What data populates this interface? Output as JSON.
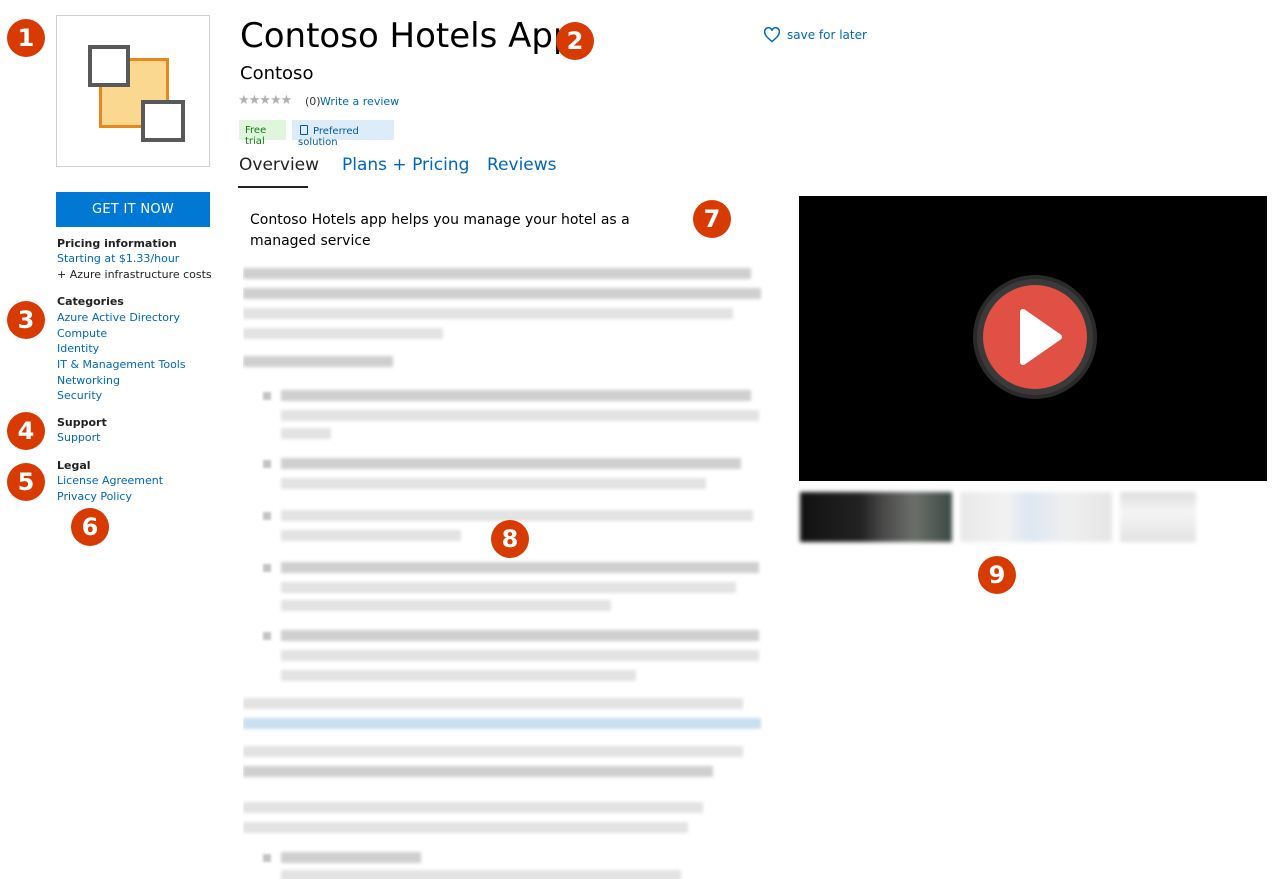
{
  "app": {
    "title": "Contoso Hotels App",
    "publisher": "Contoso",
    "rating_stars": "★★★★★",
    "rating_count": "(0)",
    "write_review": "Write a review",
    "tags": {
      "free_trial": "Free trial",
      "preferred": "Preferred solution"
    },
    "save_for_later": "save for later"
  },
  "sidebar": {
    "cta_label": "GET IT NOW",
    "pricing": {
      "heading": "Pricing information",
      "link": "Starting at $1.33/hour",
      "note": "+ Azure infrastructure costs"
    },
    "categories": {
      "heading": "Categories",
      "items": [
        "Azure Active Directory",
        "Compute",
        "Identity",
        "IT & Management Tools",
        "Networking",
        "Security"
      ]
    },
    "support": {
      "heading": "Support",
      "link": "Support"
    },
    "legal": {
      "heading": "Legal",
      "links": [
        "License Agreement",
        "Privacy Policy"
      ]
    }
  },
  "tabs": [
    "Overview",
    "Plans + Pricing",
    "Reviews"
  ],
  "overview": {
    "description": "Contoso Hotels app helps you manage your hotel as a managed service"
  },
  "annotations": [
    "1",
    "2",
    "3",
    "4",
    "5",
    "6",
    "7",
    "8",
    "9"
  ],
  "colors": {
    "accent": "#0078d4",
    "badge": "#d83b01",
    "link": "#0067b8",
    "logo_orange": "#f6a74b"
  },
  "icons": {
    "save": "heart-outline-icon",
    "play": "play-icon",
    "pref": "badge-icon"
  }
}
